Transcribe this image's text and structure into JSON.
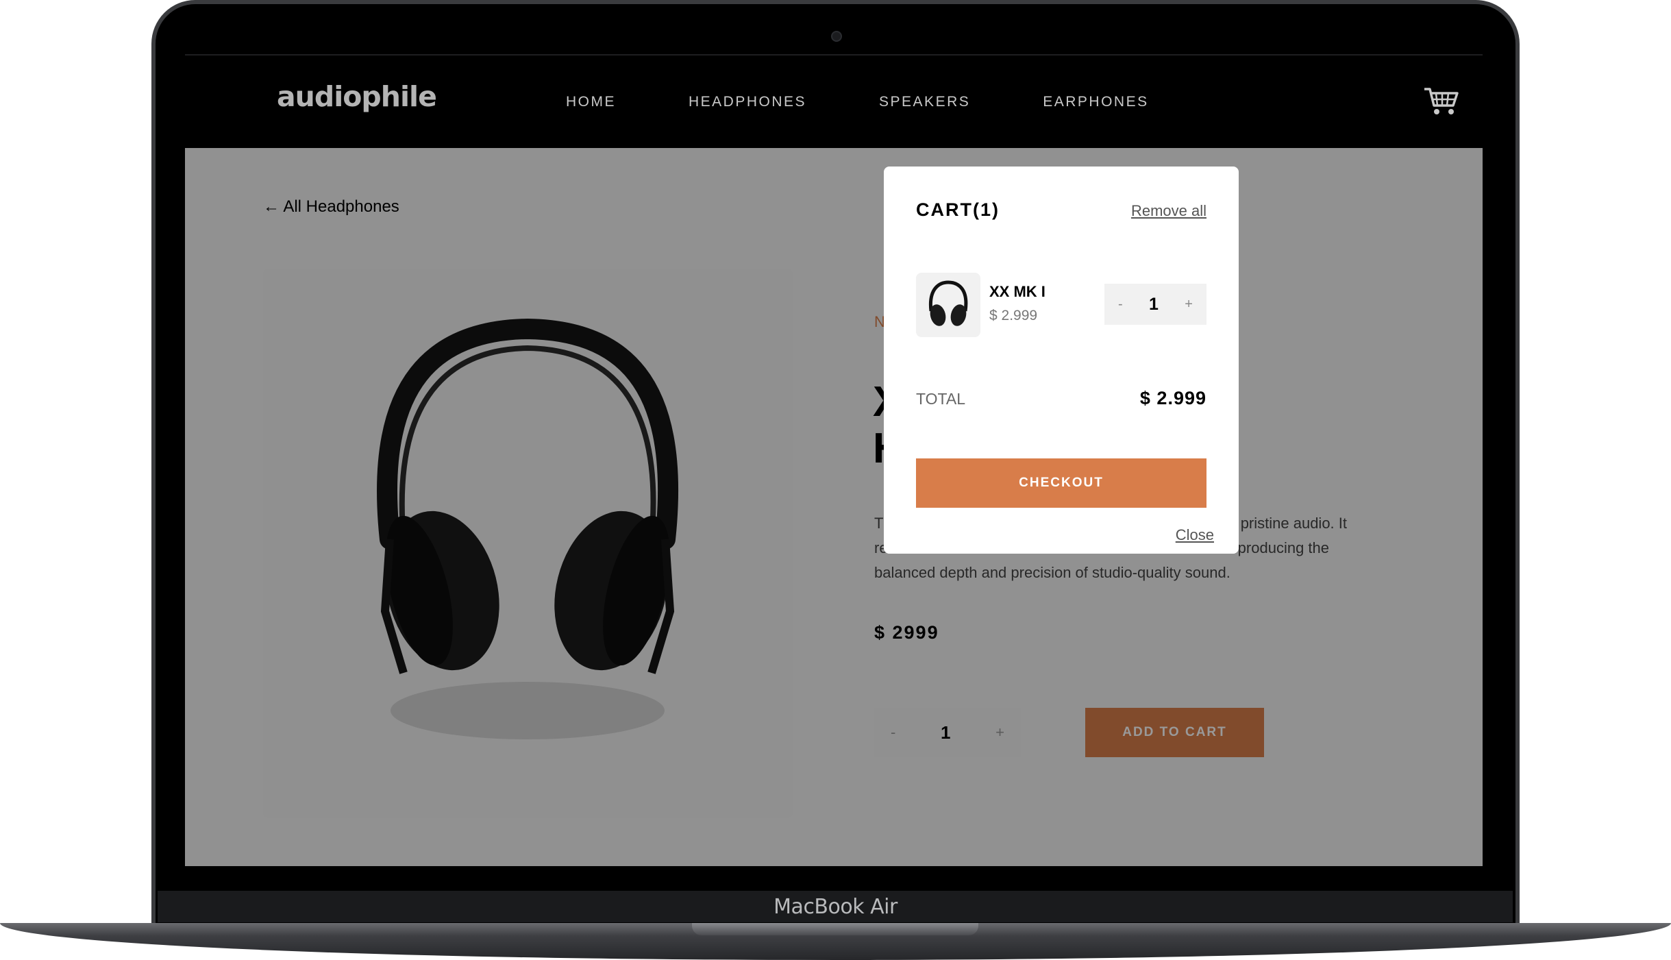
{
  "device": {
    "label": "MacBook Air"
  },
  "nav": {
    "logo": "audiophile",
    "links": [
      "HOME",
      "HEADPHONES",
      "SPEAKERS",
      "EARPHONES"
    ]
  },
  "product": {
    "back_link": "← All Headphones",
    "new_label": "N",
    "title_line1": "X",
    "title_line2": "H",
    "description_visible": [
      "T",
      "pristine audio. It",
      "re",
      "producing the",
      "balanced depth and precision of studio-quality sound."
    ],
    "price": "$ 2999",
    "quantity": "1",
    "qty_minus": "-",
    "qty_plus": "+",
    "add_to_cart": "ADD TO CART"
  },
  "cart": {
    "title": "CART(1)",
    "remove_all": "Remove all",
    "items": [
      {
        "name": "XX MK I",
        "price": "$ 2.999",
        "quantity": "1",
        "minus": "-",
        "plus": "+"
      }
    ],
    "total_label": "TOTAL",
    "total_value": "$ 2.999",
    "checkout": "CHECKOUT",
    "close": "Close"
  },
  "colors": {
    "accent": "#d87d4a",
    "nav_bg": "#000000",
    "page_bg": "#f2f2f2"
  },
  "icons": {
    "cart": "cart-icon",
    "back": "arrow-left-icon",
    "product": "headphones-image"
  }
}
